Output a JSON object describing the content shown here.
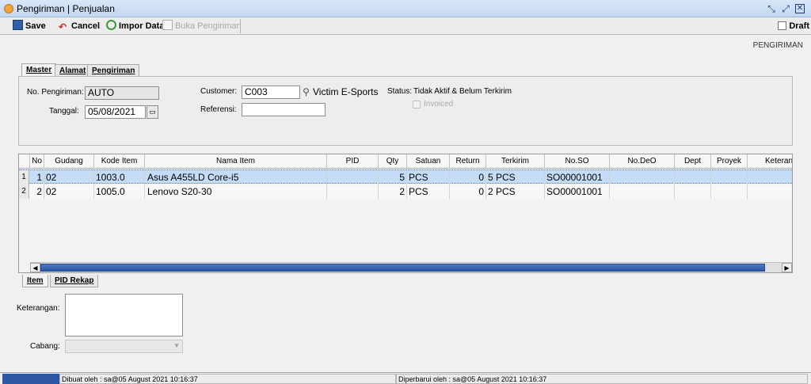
{
  "window": {
    "title": "Pengiriman | Penjualan"
  },
  "toolbar": {
    "save": "Save",
    "cancel": "Cancel",
    "impor": "Impor Data",
    "buka": "Buka Pengiriman",
    "draft": "Draft"
  },
  "page_label": "PENGIRIMAN",
  "tabs": {
    "master": "Master",
    "alamat": "Alamat",
    "pengiriman": "Pengiriman"
  },
  "form": {
    "no_label": "No. Pengiriman:",
    "no_value": "AUTO",
    "tanggal_label": "Tanggal:",
    "tanggal_value": "05/08/2021",
    "customer_label": "Customer:",
    "customer_code": "C003",
    "customer_name": "Victim E-Sports",
    "referensi_label": "Referensi:",
    "referensi_value": "",
    "status_label": "Status:",
    "status_value": "Tidak Aktif & Belum Terkirim",
    "invoiced": "Invoiced"
  },
  "grid": {
    "headers": [
      "No",
      "Gudang",
      "Kode Item",
      "Nama Item",
      "PID",
      "Qty",
      "Satuan",
      "Return",
      "Terkirim",
      "No.SO",
      "No.DeO",
      "Dept",
      "Proyek",
      "Keterangan"
    ],
    "rows": [
      {
        "row": "1",
        "no": "1",
        "gudang": "02",
        "kode": "1003.0",
        "nama": "Asus A455LD Core-i5",
        "pid": "",
        "qty": "5",
        "satuan": "PCS",
        "return": "0",
        "terkirim": "5 PCS",
        "noso": "SO00001001",
        "nodeo": "",
        "dept": "",
        "proyek": "",
        "ket": ""
      },
      {
        "row": "2",
        "no": "2",
        "gudang": "02",
        "kode": "1005.0",
        "nama": "Lenovo S20-30",
        "pid": "",
        "qty": "2",
        "satuan": "PCS",
        "return": "0",
        "terkirim": "2 PCS",
        "noso": "SO00001001",
        "nodeo": "",
        "dept": "",
        "proyek": "",
        "ket": ""
      }
    ],
    "selected_row": 0
  },
  "bottom_tabs": {
    "item": "Item",
    "pid": "PID Rekap"
  },
  "bottom": {
    "keterangan_label": "Keterangan:",
    "keterangan_value": "",
    "cabang_label": "Cabang:",
    "cabang_value": ""
  },
  "status_bar": {
    "dibuat": "Dibuat oleh : sa@05 August 2021  10:16:37",
    "diperbarui": "Diperbarui oleh : sa@05 August 2021  10:16:37"
  },
  "colors": {
    "selection": "#c5dcf7",
    "accent": "#2d56a3",
    "title_bg": "#d9e7f9"
  }
}
